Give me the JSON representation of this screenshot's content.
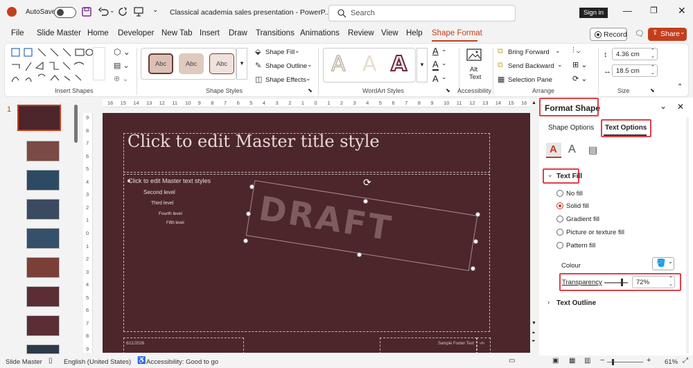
{
  "titlebar": {
    "autosave_label": "AutoSave",
    "doc_title": "Classical academia sales presentation  -  PowerP...",
    "search_placeholder": "Search",
    "signin_label": "Sign in"
  },
  "tabs": [
    "File",
    "Slide Master",
    "Home",
    "Developer",
    "New Tab",
    "Insert",
    "Draw",
    "Transitions",
    "Animations",
    "Review",
    "View",
    "Help",
    "Shape Format"
  ],
  "tab_buttons": {
    "record": "Record",
    "share": "Share"
  },
  "ribbon": {
    "insert_shapes_label": "Insert Shapes",
    "shape_styles": {
      "label": "Shape Styles",
      "swatch": "Abc",
      "fill": "Shape Fill",
      "outline": "Shape Outline",
      "effects": "Shape Effects"
    },
    "wordart": {
      "label": "WordArt Styles",
      "glyph": "A"
    },
    "accessibility": {
      "label": "Accessibility",
      "alt": "Alt",
      "text": "Text"
    },
    "arrange": {
      "label": "Arrange",
      "bring_forward": "Bring Forward",
      "send_backward": "Send Backward",
      "selection_pane": "Selection Pane"
    },
    "size": {
      "label": "Size",
      "height": "4.36 cm",
      "width": "18.5 cm"
    }
  },
  "slide_thumbs": {
    "first_number": "1"
  },
  "slide": {
    "title": "Click to edit Master title style",
    "levels": [
      "Click to edit Master text styles",
      "Second level",
      "Third level",
      "Fourth level",
      "Fifth level"
    ],
    "draft": "DRAFT",
    "date": "6/11/2026",
    "footer": "Sample Footer Text",
    "number": "‹#›"
  },
  "ruler": {
    "h": [
      "16",
      "15",
      "14",
      "13",
      "12",
      "11",
      "10",
      "9",
      "8",
      "7",
      "6",
      "5",
      "4",
      "3",
      "2",
      "1",
      "0",
      "1",
      "2",
      "3",
      "4",
      "5",
      "6",
      "7",
      "8",
      "9",
      "10",
      "11",
      "12",
      "13",
      "14",
      "15",
      "16"
    ],
    "v": [
      "9",
      "8",
      "7",
      "6",
      "5",
      "4",
      "3",
      "2",
      "1",
      "0",
      "1",
      "2",
      "3",
      "4",
      "5",
      "6",
      "7",
      "8",
      "9"
    ]
  },
  "pane": {
    "title": "Format Shape",
    "tab_shape": "Shape Options",
    "tab_text": "Text Options",
    "section_fill": "Text Fill",
    "options": [
      "No fill",
      "Solid fill",
      "Gradient fill",
      "Picture or texture fill",
      "Pattern fill"
    ],
    "selected_option": "Solid fill",
    "colour_label": "Colour",
    "transparency_label": "Transparency",
    "transparency_value": "72%",
    "section_outline": "Text Outline"
  },
  "status": {
    "view": "Slide Master",
    "language": "English (United States)",
    "accessibility": "Accessibility: Good to go",
    "zoom": "61%"
  },
  "colors": {
    "accent": "#c43e1c",
    "slide_bg": "#4c262a",
    "highlight": "#e0404a"
  }
}
